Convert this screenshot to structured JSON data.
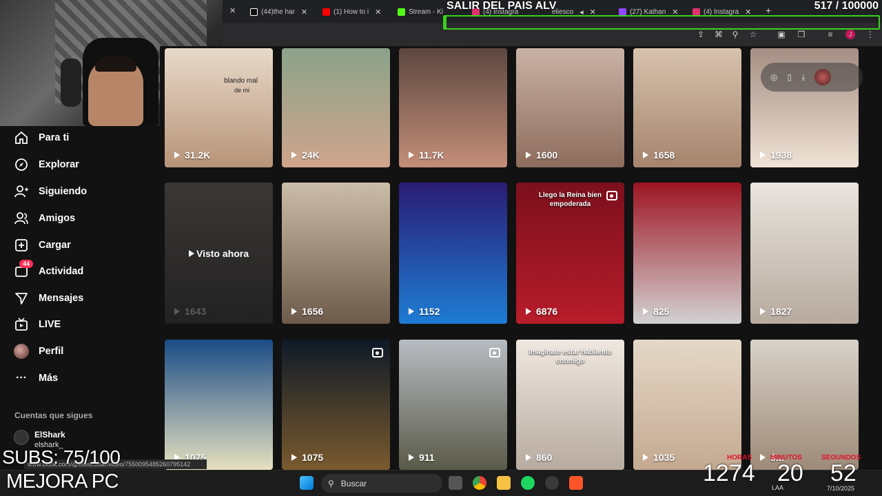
{
  "browser": {
    "tabs": [
      {
        "label": "(44)the har",
        "color": "#ffffff"
      },
      {
        "label": "(1) How to i",
        "color": "#ff0000"
      },
      {
        "label": "Stream - Ki",
        "color": "#53fc18"
      },
      {
        "label": "(4) Instagra",
        "color": "#e1306c"
      },
      {
        "label": "eliesco",
        "color": "#ffffff"
      },
      {
        "label": "(27) Kathan",
        "color": "#9146ff"
      },
      {
        "label": "(4) Instagra",
        "color": "#e1306c"
      }
    ]
  },
  "stream": {
    "goal_title": "SALIR DEL PAIS ALV",
    "goal_count": "517  / 100000",
    "goal_fraction": 0.0052,
    "subs": "SUBS: 75/100",
    "mejora": "MEJORA PC",
    "status_url": "www.tiktok.com/@eliescobar/video/7550095485260795142",
    "timer_a": "1274",
    "timer_b": "20",
    "timer_c": "52",
    "timer_labels": [
      "HORAS",
      "MINUTOS",
      "SEGUNDOS"
    ]
  },
  "sidebar": {
    "items": [
      {
        "label": "Para ti",
        "icon": "home-icon"
      },
      {
        "label": "Explorar",
        "icon": "compass-icon"
      },
      {
        "label": "Siguiendo",
        "icon": "following-icon"
      },
      {
        "label": "Amigos",
        "icon": "friends-icon"
      },
      {
        "label": "Cargar",
        "icon": "upload-icon"
      },
      {
        "label": "Actividad",
        "icon": "inbox-icon",
        "badge": "44"
      },
      {
        "label": "Mensajes",
        "icon": "send-icon"
      },
      {
        "label": "LIVE",
        "icon": "live-icon"
      },
      {
        "label": "Perfil",
        "icon": "profile-avatar"
      },
      {
        "label": "Más",
        "icon": "more-icon"
      }
    ],
    "following_title": "Cuentas que sigues",
    "following": {
      "name": "ElShark",
      "handle": "elshark_"
    }
  },
  "grid": {
    "cards": [
      {
        "views": "31.2K",
        "caption": "blando mal",
        "caption2": "de mi"
      },
      {
        "views": "24K"
      },
      {
        "views": "11.7K"
      },
      {
        "views": "1600"
      },
      {
        "views": "1658"
      },
      {
        "views": "1938"
      },
      {
        "views": "1643",
        "center": "Visto ahora"
      },
      {
        "views": "1656"
      },
      {
        "views": "1152"
      },
      {
        "views": "6876",
        "overlay": "Llego la Reina bien empoderada"
      },
      {
        "views": "825"
      },
      {
        "views": "1827"
      },
      {
        "views": "1075"
      },
      {
        "views": "1075"
      },
      {
        "views": "911"
      },
      {
        "views": "860",
        "overlay": "Imaginate estar hablando conmigo"
      },
      {
        "views": "1035"
      },
      {
        "views": "8..."
      }
    ]
  },
  "taskbar": {
    "search_placeholder": "Buscar",
    "lang": "LAA",
    "date": "7/10/2025"
  }
}
